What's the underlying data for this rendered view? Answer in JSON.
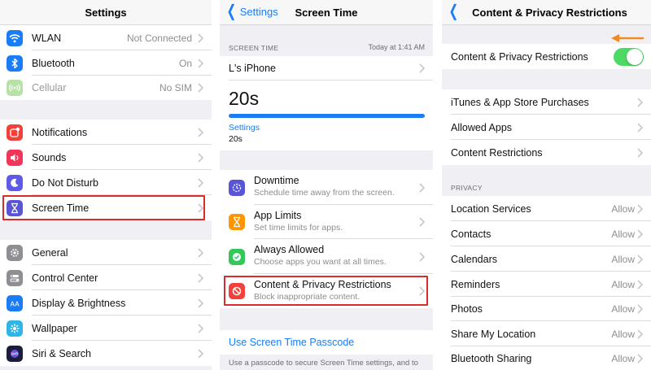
{
  "colors": {
    "accent": "#1a7cf6",
    "highlight": "#d92b2b",
    "toggle_on": "#4cd964",
    "arrow": "#f08a24"
  },
  "settings": {
    "title": "Settings",
    "rows": [
      {
        "label": "WLAN",
        "value": "Not Connected",
        "icon": "wifi-icon"
      },
      {
        "label": "Bluetooth",
        "value": "On",
        "icon": "bluetooth-icon"
      },
      {
        "label": "Cellular",
        "value": "No SIM",
        "icon": "cellular-icon"
      },
      {
        "label": "Notifications",
        "icon": "notifications-icon"
      },
      {
        "label": "Sounds",
        "icon": "sounds-icon"
      },
      {
        "label": "Do Not Disturb",
        "icon": "moon-icon"
      },
      {
        "label": "Screen Time",
        "icon": "hourglass-icon"
      },
      {
        "label": "General",
        "icon": "gear-icon"
      },
      {
        "label": "Control Center",
        "icon": "control-center-icon"
      },
      {
        "label": "Display & Brightness",
        "icon": "display-icon"
      },
      {
        "label": "Wallpaper",
        "icon": "wallpaper-icon"
      },
      {
        "label": "Siri & Search",
        "icon": "siri-icon"
      }
    ]
  },
  "screen_time": {
    "back_label": "Settings",
    "title": "Screen Time",
    "section_header": "SCREEN TIME",
    "timestamp": "Today at 1:41 AM",
    "device": "L's iPhone",
    "total": "20s",
    "progress_fraction": 1.0,
    "category_label": "Settings",
    "category_value": "20s",
    "items": [
      {
        "title": "Downtime",
        "subtitle": "Schedule time away from the screen.",
        "icon": "downtime-icon"
      },
      {
        "title": "App Limits",
        "subtitle": "Set time limits for apps.",
        "icon": "app-limits-icon"
      },
      {
        "title": "Always Allowed",
        "subtitle": "Choose apps you want at all times.",
        "icon": "always-allowed-icon"
      },
      {
        "title": "Content & Privacy Restrictions",
        "subtitle": "Block inappropriate content.",
        "icon": "restrictions-icon"
      }
    ],
    "passcode_link": "Use Screen Time Passcode",
    "footer": "Use a passcode to secure Screen Time settings, and to"
  },
  "restrictions": {
    "title": "Content & Privacy Restrictions",
    "toggle_label": "Content & Privacy Restrictions",
    "toggle_on": true,
    "store_rows": [
      {
        "label": "iTunes & App Store Purchases"
      },
      {
        "label": "Allowed Apps"
      },
      {
        "label": "Content Restrictions"
      }
    ],
    "privacy_header": "PRIVACY",
    "privacy_rows": [
      {
        "label": "Location Services",
        "value": "Allow"
      },
      {
        "label": "Contacts",
        "value": "Allow"
      },
      {
        "label": "Calendars",
        "value": "Allow"
      },
      {
        "label": "Reminders",
        "value": "Allow"
      },
      {
        "label": "Photos",
        "value": "Allow"
      },
      {
        "label": "Share My Location",
        "value": "Allow"
      },
      {
        "label": "Bluetooth Sharing",
        "value": "Allow"
      }
    ]
  }
}
